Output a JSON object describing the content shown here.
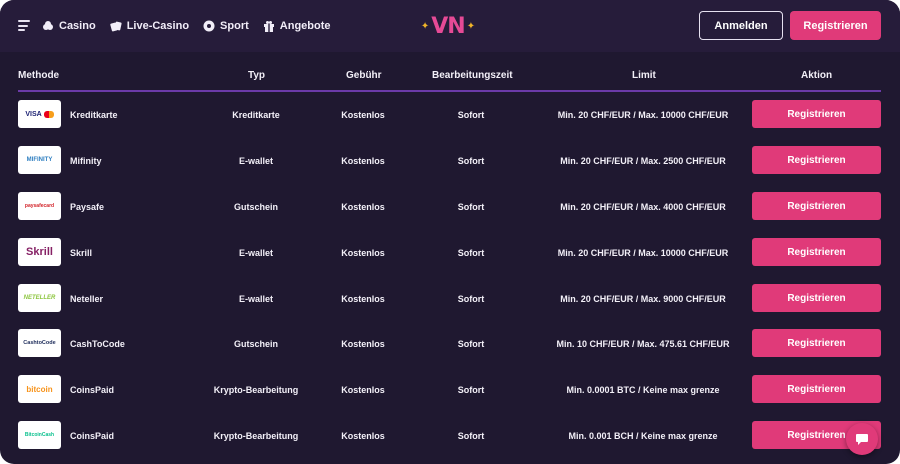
{
  "header": {
    "nav": [
      {
        "label": "Casino",
        "icon": "chip-icon"
      },
      {
        "label": "Live-Casino",
        "icon": "cards-icon"
      },
      {
        "label": "Sport",
        "icon": "ball-icon"
      },
      {
        "label": "Angebote",
        "icon": "gift-icon"
      }
    ],
    "logo_text": "VN",
    "login_label": "Anmelden",
    "register_label": "Registrieren"
  },
  "table": {
    "columns": [
      "Methode",
      "Typ",
      "Gebühr",
      "Bearbeitungszeit",
      "Limit",
      "Aktion"
    ],
    "rows": [
      {
        "logo": "VISA",
        "name": "Kreditkarte",
        "type": "Kreditkarte",
        "fee": "Kostenlos",
        "time": "Sofort",
        "limit": "Min. 20 CHF/EUR / Max. 10000 CHF/EUR",
        "action": "Registrieren"
      },
      {
        "logo": "MIFINITY",
        "name": "Mifinity",
        "type": "E-wallet",
        "fee": "Kostenlos",
        "time": "Sofort",
        "limit": "Min. 20 CHF/EUR / Max. 2500 CHF/EUR",
        "action": "Registrieren"
      },
      {
        "logo": "paysafecard",
        "name": "Paysafe",
        "type": "Gutschein",
        "fee": "Kostenlos",
        "time": "Sofort",
        "limit": "Min. 20 CHF/EUR / Max. 4000 CHF/EUR",
        "action": "Registrieren"
      },
      {
        "logo": "Skrill",
        "name": "Skrill",
        "type": "E-wallet",
        "fee": "Kostenlos",
        "time": "Sofort",
        "limit": "Min. 20 CHF/EUR / Max. 10000 CHF/EUR",
        "action": "Registrieren"
      },
      {
        "logo": "NETELLER",
        "name": "Neteller",
        "type": "E-wallet",
        "fee": "Kostenlos",
        "time": "Sofort",
        "limit": "Min. 20 CHF/EUR / Max. 9000 CHF/EUR",
        "action": "Registrieren"
      },
      {
        "logo": "CashtoCode",
        "name": "CashToCode",
        "type": "Gutschein",
        "fee": "Kostenlos",
        "time": "Sofort",
        "limit": "Min. 10 CHF/EUR / Max. 475.61 CHF/EUR",
        "action": "Registrieren"
      },
      {
        "logo": "bitcoin",
        "name": "CoinsPaid",
        "type": "Krypto-Bearbeitung",
        "fee": "Kostenlos",
        "time": "Sofort",
        "limit": "Min. 0.0001 BTC / Keine max grenze",
        "action": "Registrieren"
      },
      {
        "logo": "BitcoinCash",
        "name": "CoinsPaid",
        "type": "Krypto-Bearbeitung",
        "fee": "Kostenlos",
        "time": "Sofort",
        "limit": "Min. 0.001 BCH / Keine max grenze",
        "action": "Registrieren"
      }
    ]
  },
  "colors": {
    "background": "#1f1830",
    "header": "#261c3a",
    "accent": "#e03a79",
    "divider": "#6b3aa8"
  }
}
